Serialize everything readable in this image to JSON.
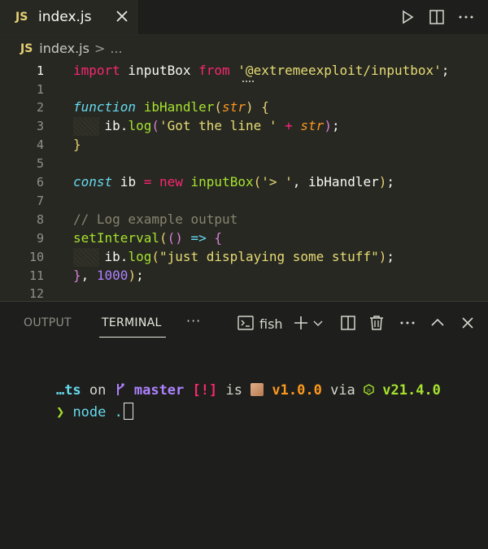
{
  "tab": {
    "badge": "JS",
    "title": "index.js"
  },
  "breadcrumb": {
    "badge": "JS",
    "file": "index.js",
    "separator": ">",
    "more": "..."
  },
  "editor": {
    "lines": [
      {
        "num": "1",
        "tokens": [
          [
            "kw",
            "import"
          ],
          [
            "plain",
            " inputBox "
          ],
          [
            "kw",
            "from"
          ],
          [
            "plain",
            " "
          ],
          [
            "str",
            "'@extremeexploit/inputbox'"
          ],
          [
            "plain",
            ";"
          ]
        ]
      },
      {
        "num": "1",
        "tokens": []
      },
      {
        "num": "2",
        "tokens": [
          [
            "it",
            "function"
          ],
          [
            "plain",
            " "
          ],
          [
            "fn",
            "ibHandler"
          ],
          [
            "br1",
            "("
          ],
          [
            "param",
            "str"
          ],
          [
            "br1",
            ")"
          ],
          [
            "plain",
            " "
          ],
          [
            "br1",
            "{"
          ]
        ]
      },
      {
        "num": "3",
        "tokens": [
          [
            "plain",
            "    ib."
          ],
          [
            "fn",
            "log"
          ],
          [
            "br2",
            "("
          ],
          [
            "str",
            "'Got the line '"
          ],
          [
            "plain",
            " "
          ],
          [
            "kw",
            "+"
          ],
          [
            "plain",
            " "
          ],
          [
            "param",
            "str"
          ],
          [
            "br2",
            ")"
          ],
          [
            "plain",
            ";"
          ]
        ]
      },
      {
        "num": "4",
        "tokens": [
          [
            "br1",
            "}"
          ]
        ]
      },
      {
        "num": "5",
        "tokens": []
      },
      {
        "num": "6",
        "tokens": [
          [
            "it",
            "const"
          ],
          [
            "plain",
            " ib "
          ],
          [
            "kw",
            "="
          ],
          [
            "plain",
            " "
          ],
          [
            "kw",
            "new"
          ],
          [
            "plain",
            " "
          ],
          [
            "fn",
            "inputBox"
          ],
          [
            "br1",
            "("
          ],
          [
            "str",
            "'> '"
          ],
          [
            "plain",
            ", ibHandler"
          ],
          [
            "br1",
            ")"
          ],
          [
            "plain",
            ";"
          ]
        ]
      },
      {
        "num": "7",
        "tokens": []
      },
      {
        "num": "8",
        "tokens": [
          [
            "cmt",
            "// Log example output"
          ]
        ]
      },
      {
        "num": "9",
        "tokens": [
          [
            "fn",
            "setInterval"
          ],
          [
            "br1",
            "("
          ],
          [
            "br2",
            "()"
          ],
          [
            "plain",
            " "
          ],
          [
            "it",
            "=>"
          ],
          [
            "plain",
            " "
          ],
          [
            "br2",
            "{"
          ]
        ]
      },
      {
        "num": "10",
        "tokens": [
          [
            "plain",
            "    ib."
          ],
          [
            "fn",
            "log"
          ],
          [
            "br1",
            "("
          ],
          [
            "str",
            "\"just displaying some stuff\""
          ],
          [
            "br1",
            ")"
          ],
          [
            "plain",
            ";"
          ]
        ]
      },
      {
        "num": "11",
        "tokens": [
          [
            "br2",
            "}"
          ],
          [
            "plain",
            ", "
          ],
          [
            "num",
            "1000"
          ],
          [
            "br1",
            ")"
          ],
          [
            "plain",
            ";"
          ]
        ]
      },
      {
        "num": "12",
        "tokens": []
      }
    ]
  },
  "panel": {
    "tabs": [
      "OUTPUT",
      "TERMINAL"
    ],
    "more": "···",
    "shell": "fish"
  },
  "terminal": {
    "dir": "…ts",
    "on": " on ",
    "branch": " master",
    "status": " [!]",
    "is": " is ",
    "version": " v1.0.0",
    "via": " via ",
    "node_version": " v21.4.0",
    "prompt": "❯",
    "command": " node ."
  },
  "colors": {
    "keyword": "#f92672",
    "function": "#a6e22e",
    "string": "#e6db74",
    "italic_keyword": "#66d9ef",
    "param": "#fd971f",
    "comment": "#88846f",
    "number": "#ae81ff"
  }
}
